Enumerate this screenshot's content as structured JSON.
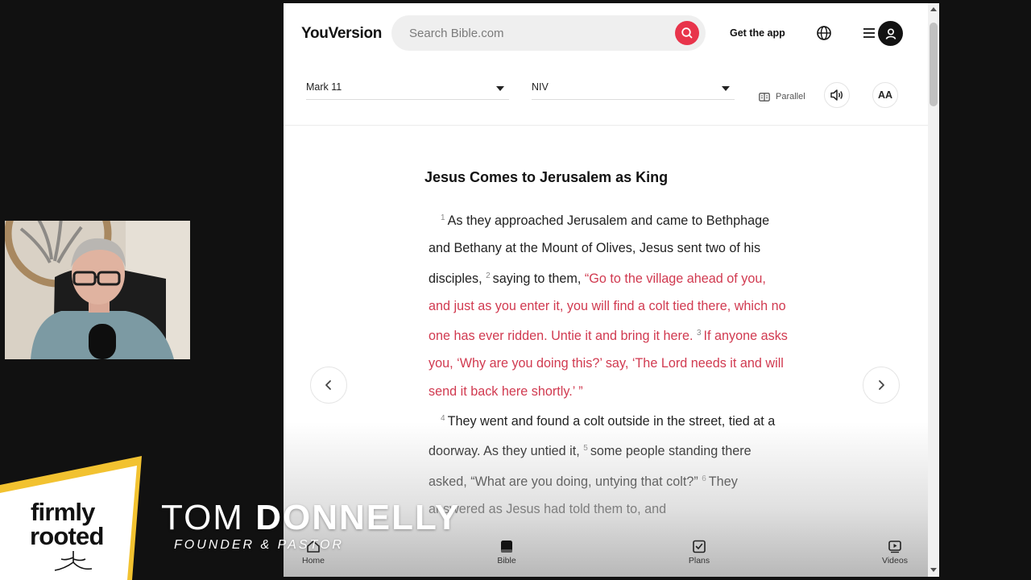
{
  "header": {
    "logo": "YouVersion",
    "search_placeholder": "Search Bible.com",
    "get_app_label": "Get the app",
    "icons": {
      "search": "search-icon",
      "language": "globe-icon",
      "menu": "hamburger-menu-icon",
      "account": "user-icon"
    }
  },
  "toolbar": {
    "book_chapter": "Mark 11",
    "version": "NIV",
    "parallel_label": "Parallel",
    "font_button_label": "AA",
    "icons": {
      "parallel": "parallel-columns-icon",
      "audio": "speaker-icon"
    }
  },
  "reader": {
    "heading": "Jesus Comes to Jerusalem as King",
    "verses": [
      {
        "num": "1",
        "text": "As they approached Jerusalem and came to Bethphage and Bethany at the Mount of Olives, Jesus sent two of his disciples,"
      },
      {
        "num": "2",
        "text": "saying to them,",
        "red": "“Go to the village ahead of you, and just as you enter it, you will find a colt tied there, which no one has ever ridden. Untie it and bring it here."
      },
      {
        "num": "3",
        "red": "If anyone asks you, ‘Why are you doing this?’ say, ‘The Lord needs it and will send it back here shortly.’ ”"
      },
      {
        "num": "4",
        "text": "They went and found a colt outside in the street, tied at a doorway. As they untied it,"
      },
      {
        "num": "5",
        "text": "some people standing there asked, “What are you doing, untying that colt?”"
      },
      {
        "num": "6",
        "text": "They answered as Jesus had told them to, and"
      }
    ],
    "prev_icon": "chevron-left-icon",
    "next_icon": "chevron-right-icon"
  },
  "bottom_nav": {
    "items": [
      {
        "label": "Home",
        "icon": "home-icon"
      },
      {
        "label": "Bible",
        "icon": "bible-icon"
      },
      {
        "label": "Plans",
        "icon": "plans-check-icon"
      },
      {
        "label": "Videos",
        "icon": "video-icon"
      }
    ]
  },
  "overlay": {
    "brand_line1": "firmly",
    "brand_line2": "rooted",
    "presenter_first": "TOM",
    "presenter_last": "DONNELLY",
    "presenter_title": "FOUNDER & PASTOR"
  },
  "colors": {
    "accent_red": "#e8344b",
    "words_of_jesus": "#d13a50",
    "brand_gold": "#f2c230"
  }
}
